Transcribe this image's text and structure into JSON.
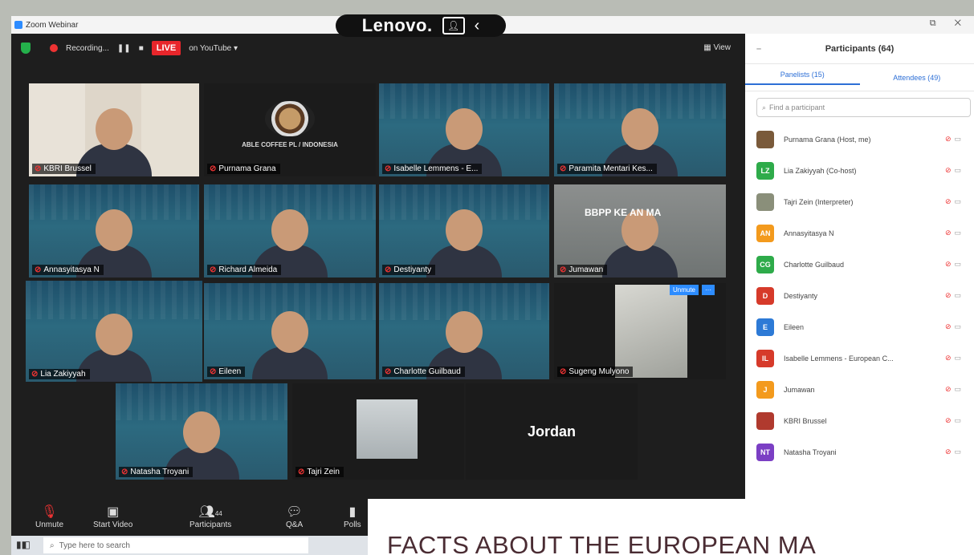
{
  "window": {
    "title": "Zoom Webinar"
  },
  "brand": {
    "name": "Lenovo."
  },
  "toolbar": {
    "recording_label": "Recording...",
    "live_label": "LIVE",
    "stream_label": "on YouTube ▾",
    "view_label": "▦ View"
  },
  "tiles": [
    {
      "name": "KBRI Brussel",
      "theme": "room"
    },
    {
      "name": "Purnama Grana",
      "theme": "logo",
      "logo_text": "ABLE COFFEE PL / INDONESIA"
    },
    {
      "name": "Isabelle Lemmens - E...",
      "theme": "banner"
    },
    {
      "name": "Paramita Mentari Kes...",
      "theme": "banner"
    },
    {
      "name": "Annasyitasya N",
      "theme": "banner"
    },
    {
      "name": "Richard Almeida",
      "theme": "banner"
    },
    {
      "name": "Destiyanty",
      "theme": "banner"
    },
    {
      "name": "Jumawan",
      "theme": "gray",
      "room_text": "BBPP KE  AN MA"
    },
    {
      "name": "Lia Zakiyyah",
      "theme": "banner",
      "active": true
    },
    {
      "name": "Eileen",
      "theme": "banner"
    },
    {
      "name": "Charlotte Guilbaud",
      "theme": "banner"
    },
    {
      "name": "Sugeng Mulyono",
      "theme": "photo",
      "unmute_label": "Unmute"
    },
    {
      "name": "Natasha Troyani",
      "theme": "banner"
    },
    {
      "name": "Tajri Zein",
      "theme": "small"
    },
    {
      "name": "Jordan",
      "theme": "text"
    }
  ],
  "controls": {
    "unmute": "Unmute",
    "start_video": "Start Video",
    "participants": "Participants",
    "participants_count": "44",
    "qa": "Q&A",
    "polls": "Polls"
  },
  "panel": {
    "title": "Participants (64)",
    "panelists_tab": "Panelists (15)",
    "attendees_tab": "Attendees (49)",
    "search_placeholder": "Find a participant",
    "participants": [
      {
        "name": "Purnama Grana (Host, me)",
        "initials": "",
        "color": "#7a5a3a"
      },
      {
        "name": "Lia Zakiyyah (Co-host)",
        "initials": "LZ",
        "color": "#2eab4a"
      },
      {
        "name": "Tajri Zein (Interpreter)",
        "initials": "",
        "color": "#8a8f7a"
      },
      {
        "name": "Annasyitasya N",
        "initials": "AN",
        "color": "#f39a1d"
      },
      {
        "name": "Charlotte Guilbaud",
        "initials": "CG",
        "color": "#2eab4a"
      },
      {
        "name": "Destiyanty",
        "initials": "D",
        "color": "#d63a2a"
      },
      {
        "name": "Eileen",
        "initials": "E",
        "color": "#2d7ad6"
      },
      {
        "name": "Isabelle Lemmens - European C...",
        "initials": "IL",
        "color": "#d63a2a"
      },
      {
        "name": "Jumawan",
        "initials": "J",
        "color": "#f39a1d"
      },
      {
        "name": "KBRI Brussel",
        "initials": "",
        "color": "#b03a2e"
      },
      {
        "name": "Natasha Troyani",
        "initials": "NT",
        "color": "#7b3fc4"
      }
    ]
  },
  "taskbar": {
    "search_placeholder": "Type here to search"
  },
  "overlay": {
    "title": "FACTS ABOUT THE EUROPEAN MA"
  }
}
